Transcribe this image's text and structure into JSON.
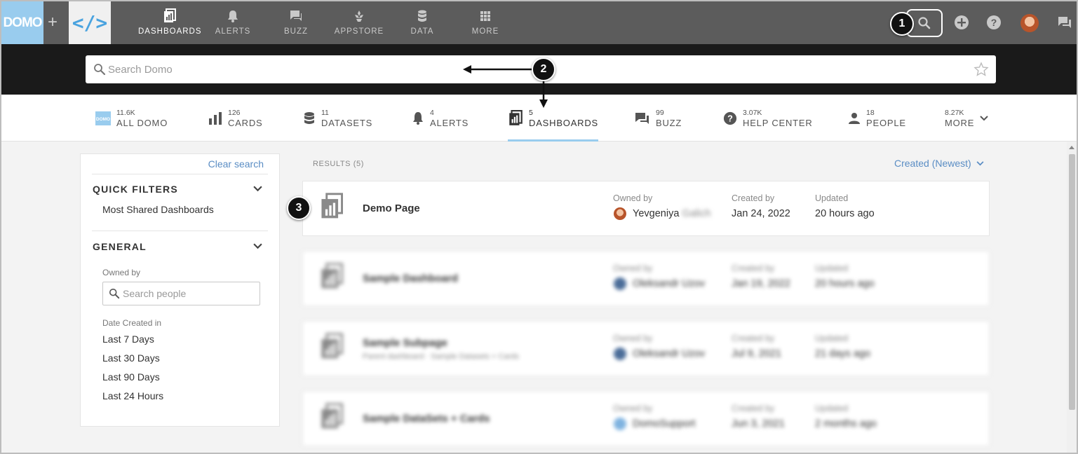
{
  "topnav": {
    "logo_text": "DOMO",
    "plus": "+",
    "code_logo": "</>",
    "items": [
      {
        "label": "DASHBOARDS",
        "icon": "dashboard-icon"
      },
      {
        "label": "ALERTS",
        "icon": "bell-icon"
      },
      {
        "label": "BUZZ",
        "icon": "chat-icon"
      },
      {
        "label": "APPSTORE",
        "icon": "appstore-icon"
      },
      {
        "label": "DATA",
        "icon": "database-icon"
      },
      {
        "label": "MORE",
        "icon": "grid-icon"
      }
    ],
    "right_icons": [
      "search-icon",
      "add-icon",
      "help-icon",
      "avatar",
      "chat-icon"
    ]
  },
  "search": {
    "placeholder": "Search Domo"
  },
  "tabs": [
    {
      "count": "11.6K",
      "label": "ALL DOMO",
      "icon": "domo-logo-icon"
    },
    {
      "count": "126",
      "label": "CARDS",
      "icon": "bar-chart-icon"
    },
    {
      "count": "11",
      "label": "DATASETS",
      "icon": "database-icon"
    },
    {
      "count": "4",
      "label": "ALERTS",
      "icon": "bell-icon"
    },
    {
      "count": "5",
      "label": "DASHBOARDS",
      "icon": "dashboard-icon",
      "active": true
    },
    {
      "count": "99",
      "label": "BUZZ",
      "icon": "chat-icon"
    },
    {
      "count": "3.07K",
      "label": "HELP CENTER",
      "icon": "help-icon"
    },
    {
      "count": "18",
      "label": "PEOPLE",
      "icon": "person-icon"
    },
    {
      "count": "8.27K",
      "label": "MORE",
      "icon": "chevron-down-icon"
    }
  ],
  "sidebar": {
    "clear_search": "Clear search",
    "quick_filters": {
      "title": "QUICK FILTERS",
      "items": [
        "Most Shared Dashboards"
      ]
    },
    "general": {
      "title": "GENERAL",
      "owned_by_label": "Owned by",
      "people_placeholder": "Search people",
      "date_created_label": "Date Created in",
      "date_options": [
        "Last 7 Days",
        "Last 30 Days",
        "Last 90 Days",
        "Last 24 Hours"
      ]
    }
  },
  "results": {
    "label": "RESULTS (5)",
    "sort": "Created (Newest)",
    "columns": {
      "owned_by": "Owned by",
      "created_by": "Created by",
      "updated": "Updated"
    },
    "items": [
      {
        "title": "Demo Page",
        "subtitle": "",
        "owner_first": "Yevgeniya",
        "owner_last": "Galich",
        "created": "Jan 24, 2022",
        "updated": "20 hours ago",
        "blurred": false
      },
      {
        "title": "Sample Dashboard",
        "subtitle": "",
        "owner_first": "Oleksandr",
        "owner_last": "Uzov",
        "created": "Jan 19, 2022",
        "updated": "20 hours ago",
        "blurred": true
      },
      {
        "title": "Sample Subpage",
        "subtitle": "Parent dashboard · Sample Datasets + Cards",
        "owner_first": "Oleksandr",
        "owner_last": "Uzov",
        "created": "Jul 9, 2021",
        "updated": "21 days ago",
        "blurred": true
      },
      {
        "title": "Sample DataSets + Cards",
        "subtitle": "",
        "owner_first": "DomoSupport",
        "owner_last": "",
        "created": "Jun 3, 2021",
        "updated": "2 months ago",
        "blurred": true
      }
    ]
  },
  "callouts": [
    "1",
    "2",
    "3"
  ],
  "colors": {
    "accent": "#99ccee",
    "link": "#5a8dc4",
    "topbar": "#5c5c5c",
    "searchband": "#1a1a1a"
  }
}
